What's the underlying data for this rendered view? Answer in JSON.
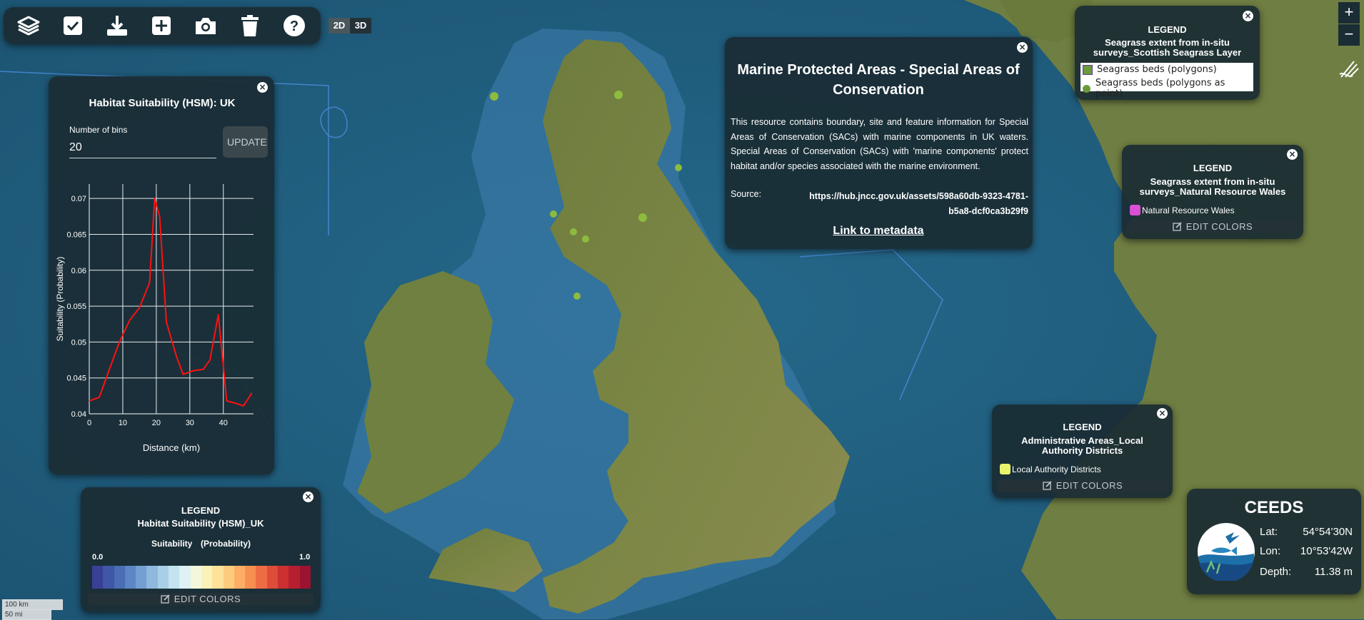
{
  "toolbar": {
    "tools": [
      "layers-icon",
      "checkbox-icon",
      "download-icon",
      "add-icon",
      "camera-icon",
      "trash-icon",
      "help-icon"
    ],
    "dim_2d": "2D",
    "dim_3d": "3D"
  },
  "zoom": {
    "in": "+",
    "out": "−"
  },
  "hsm": {
    "title": "Habitat Suitability (HSM): UK",
    "bins_label": "Number of bins",
    "bins_value": "20",
    "update": "UPDATE",
    "close": "×"
  },
  "chart_data": {
    "type": "line",
    "xlabel": "Distance (km)",
    "ylabel": "Suitability (Probability)",
    "xlim": [
      0,
      49
    ],
    "ylim": [
      0.04,
      0.072
    ],
    "xticks": [
      0,
      10,
      20,
      30,
      40
    ],
    "yticks": [
      0.04,
      0.045,
      0.05,
      0.055,
      0.06,
      0.065,
      0.07
    ],
    "ytick_labels": [
      "0.04",
      "0.045",
      "0.05",
      "0.055",
      "0.06",
      "0.065",
      "0.07"
    ],
    "grid": true,
    "series": [
      {
        "color": "#ff1111",
        "x": [
          0,
          3,
          6,
          9,
          12,
          15,
          18,
          19.5,
          21,
          23,
          26,
          28,
          31,
          34,
          36,
          38.5,
          41,
          43.5,
          46,
          48.5
        ],
        "y": [
          0.0418,
          0.0423,
          0.0462,
          0.05,
          0.053,
          0.0548,
          0.0583,
          0.07,
          0.0675,
          0.0528,
          0.048,
          0.0455,
          0.046,
          0.0462,
          0.0475,
          0.0538,
          0.0418,
          0.0415,
          0.0411,
          0.0429
        ]
      }
    ]
  },
  "hsm_legend": {
    "heading": "LEGEND",
    "subtitle": "Habitat Suitability (HSM)_UK",
    "scale_title": "Suitability",
    "scale_unit": "(Probability)",
    "min_label": "0.0",
    "max_label": "1.0",
    "colors": [
      "#3a3f97",
      "#4056a6",
      "#4a6db5",
      "#5c86c4",
      "#749fd2",
      "#8fb8de",
      "#a9cfe8",
      "#c4e3f1",
      "#dff1f5",
      "#f3f8dc",
      "#fbf2b9",
      "#fde29a",
      "#fdcb7c",
      "#fcaf64",
      "#f78f51",
      "#ee6c44",
      "#de4c3a",
      "#cc3030",
      "#b51f30",
      "#9c1332"
    ],
    "edit": "EDIT COLORS",
    "close": "×"
  },
  "mpa": {
    "title": "Marine Protected Areas - Special Areas of Conservation",
    "description": "This resource contains boundary, site and feature information for Special Areas of Conservation (SACs) with marine components in UK waters. Special Areas of Conservation (SACs) with 'marine components' protect habitat and/or species associated with the marine environment.",
    "source_label": "Source:",
    "source_link": "https://hub.jncc.gov.uk/assets/598a60db-9323-4781-b5a8-dcf0ca3b29f9",
    "metadata_link": "Link to metadata",
    "close": "×"
  },
  "seagrass_scot": {
    "heading": "LEGEND",
    "subtitle": "Seagrass extent from in-situ surveys_Scottish Seagrass Layer",
    "items": [
      {
        "label": "Seagrass beds (polygons)",
        "color": "#6a9a3a"
      },
      {
        "label": "Seagrass beds (polygons as point)",
        "color": "#6a9a3a"
      }
    ],
    "close": "×"
  },
  "seagrass_wales": {
    "heading": "LEGEND",
    "subtitle": "Seagrass extent from in-situ surveys_Natural Resource Wales",
    "item_label": "Natural Resource Wales",
    "item_color": "#d94fd6",
    "edit": "EDIT COLORS",
    "close": "×"
  },
  "admin": {
    "heading": "LEGEND",
    "subtitle": "Administrative Areas_Local Authority Districts",
    "item_label": "Local Authority Districts",
    "item_color": "#e8f56a",
    "edit": "EDIT COLORS",
    "close": "×"
  },
  "ceeds": {
    "title": "CEEDS",
    "lat_label": "Lat:",
    "lat": "54°54'30N",
    "lon_label": "Lon:",
    "lon": "10°53'42W",
    "depth_label": "Depth:",
    "depth": "11.38 m"
  },
  "scale": {
    "km": "100 km",
    "mi": "50 mi"
  },
  "colors": {
    "panel": "#1a2c34",
    "accent": "#243238"
  }
}
